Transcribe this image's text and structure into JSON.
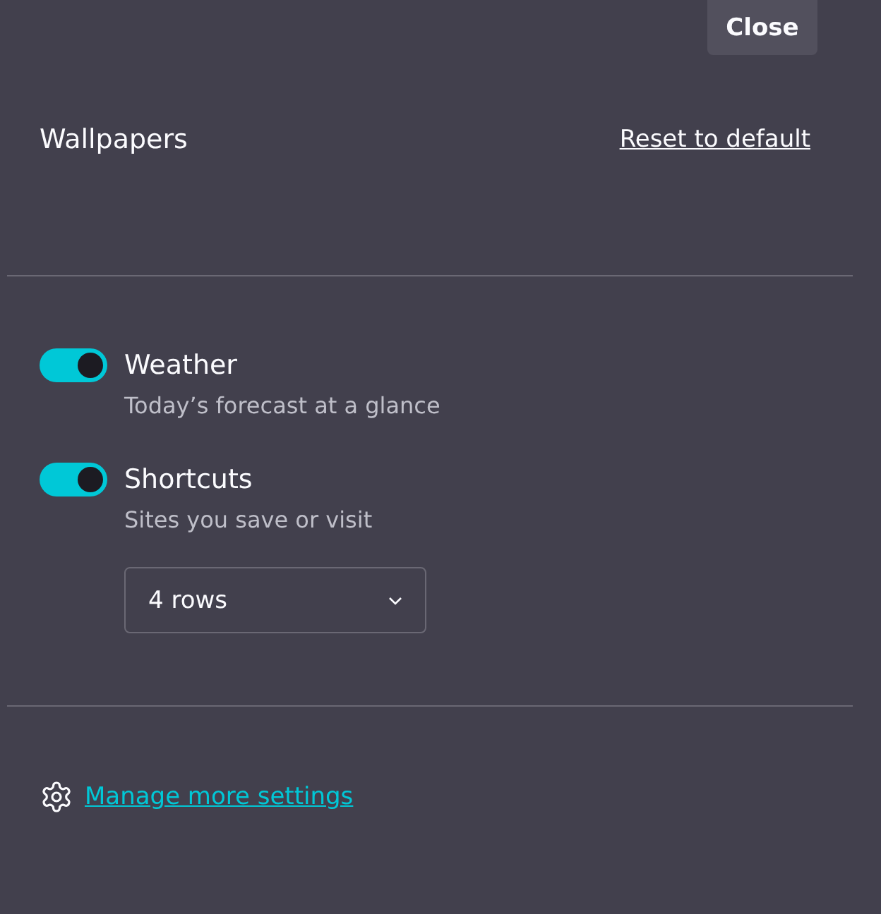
{
  "close_button": "Close",
  "wallpapers": {
    "title": "Wallpapers",
    "reset_link": "Reset to default"
  },
  "widgets": [
    {
      "label": "Weather",
      "description": "Today’s forecast at a glance",
      "on": true
    },
    {
      "label": "Shortcuts",
      "description": "Sites you save or visit",
      "on": true,
      "select": {
        "value": "4 rows"
      }
    }
  ],
  "footer_link": "Manage more settings"
}
